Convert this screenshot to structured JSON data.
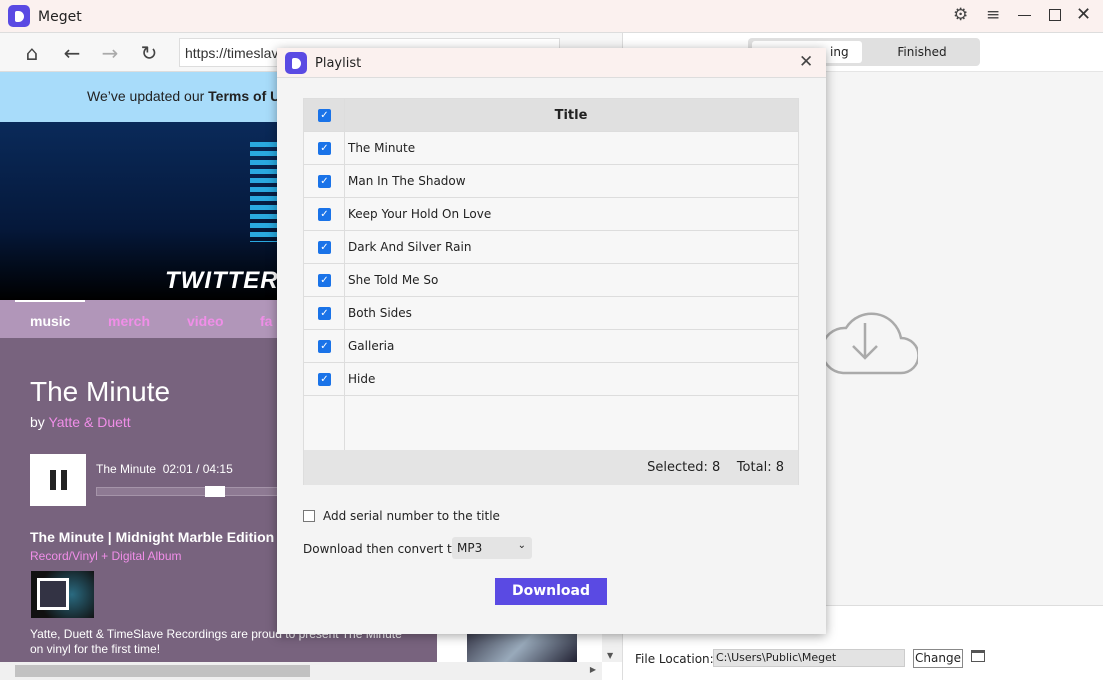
{
  "app": {
    "title": "Meget",
    "icons": [
      "gear-icon",
      "menu-icon",
      "minimize-icon",
      "maximize-icon",
      "close-icon"
    ]
  },
  "browser": {
    "url": "https://timeslav",
    "banner_text": "We’ve updated our ",
    "banner_bold": "Terms of U",
    "hero_text": "TWITTER /",
    "nav": [
      "music",
      "merch",
      "video",
      "fa"
    ],
    "track_title": "The Minute",
    "by": "by ",
    "artist": "Yatte & Duett",
    "player": {
      "track": "The Minute",
      "time": "02:01 / 04:15",
      "progress": 0.47
    },
    "product_title": "The Minute | Midnight Marble Edition",
    "product_sub": "Record/Vinyl + Digital Album",
    "desc_1": "Yatte, Duett & TimeSlave Recordings are proud to present The Minute",
    "desc_2": "on vinyl for the first time!"
  },
  "downloader": {
    "tabs": [
      "Downloading",
      "Finished"
    ],
    "active_tab": "Downloading",
    "tab_visible": "ing",
    "file_location_label": "File Location:",
    "file_location": "C:\\Users\\Public\\Meget",
    "change_label": "Change"
  },
  "playlist": {
    "title": "Playlist",
    "column": "Title",
    "items": [
      "The Minute",
      "Man In The Shadow",
      "Keep Your Hold On Love",
      "Dark And Silver Rain",
      "She Told Me So",
      "Both Sides",
      "Galleria",
      "Hide"
    ],
    "selected_label": "Selected:",
    "selected": "8",
    "total_label": "Total:",
    "total": "8",
    "serial_label": "Add serial number to the title",
    "serial_checked": false,
    "convert_label": "Download then convert to:",
    "format": "MP3",
    "download_label": "Download",
    "accent": "#5a4ae3"
  }
}
